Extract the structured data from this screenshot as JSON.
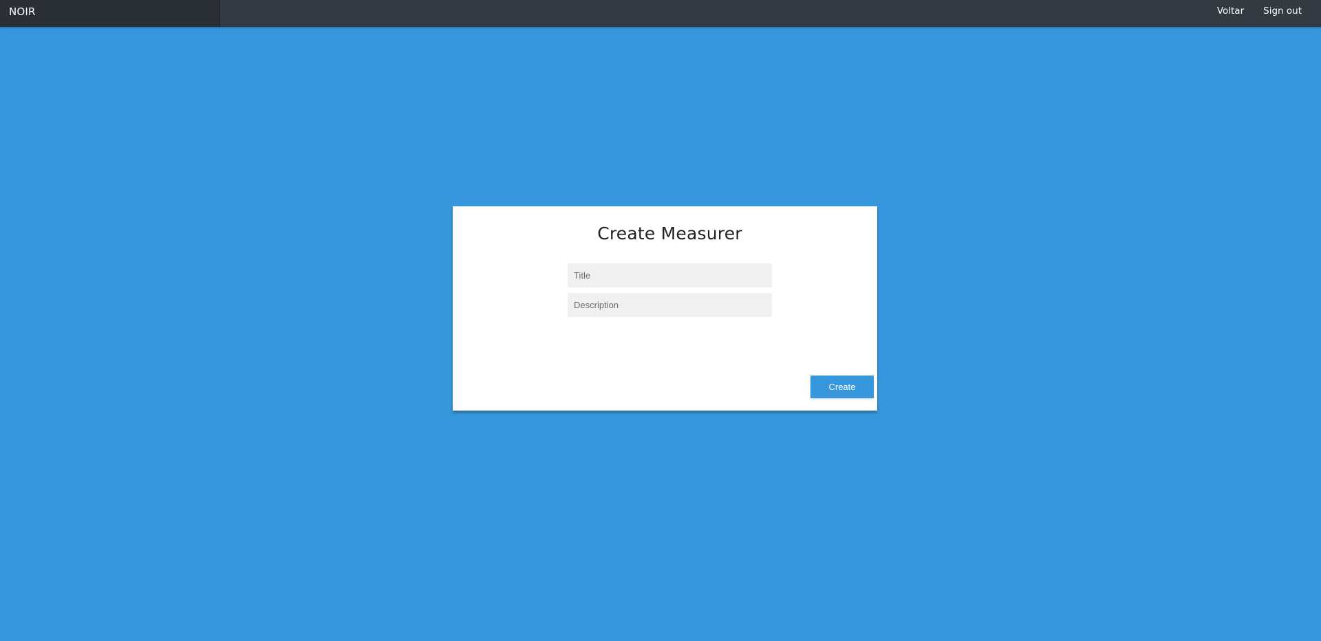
{
  "navbar": {
    "brand": "NOIR",
    "links": [
      {
        "label": "Voltar"
      },
      {
        "label": "Sign out"
      }
    ]
  },
  "form": {
    "heading": "Create Measurer",
    "title_field": {
      "value": "",
      "placeholder": "Title"
    },
    "description_field": {
      "value": "",
      "placeholder": "Description"
    },
    "submit_label": "Create"
  },
  "colors": {
    "background": "#3797dc",
    "navbar": "#343a41",
    "brand_box": "#2a2f35",
    "card": "#ffffff",
    "input_bg": "#f0f0f0",
    "button": "#3797dc"
  }
}
